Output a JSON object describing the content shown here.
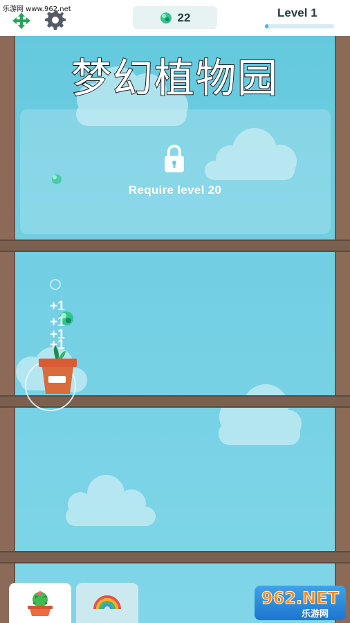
{
  "watermark": {
    "top": "乐游网 www.962.net",
    "brand": "962.NET",
    "site": "乐游网"
  },
  "hud": {
    "gem_count": "22",
    "level_label": "Level 1",
    "level_progress": 0.05
  },
  "game": {
    "title": "梦幻植物园",
    "locked_text": "Require level 20",
    "plus_labels": [
      "+1",
      "+1",
      "+1",
      "+1"
    ]
  },
  "icons": {
    "move": "move-arrows-icon",
    "settings": "gear-icon",
    "gem": "green-gem-icon",
    "lock": "lock-icon",
    "tab_plant": "cactus-pot-icon",
    "tab_rainbow": "rainbow-icon"
  },
  "colors": {
    "sky": "#72cfe3",
    "wood": "#8b6b57",
    "accent": "#40b8d8",
    "gem": "#30c68e"
  }
}
